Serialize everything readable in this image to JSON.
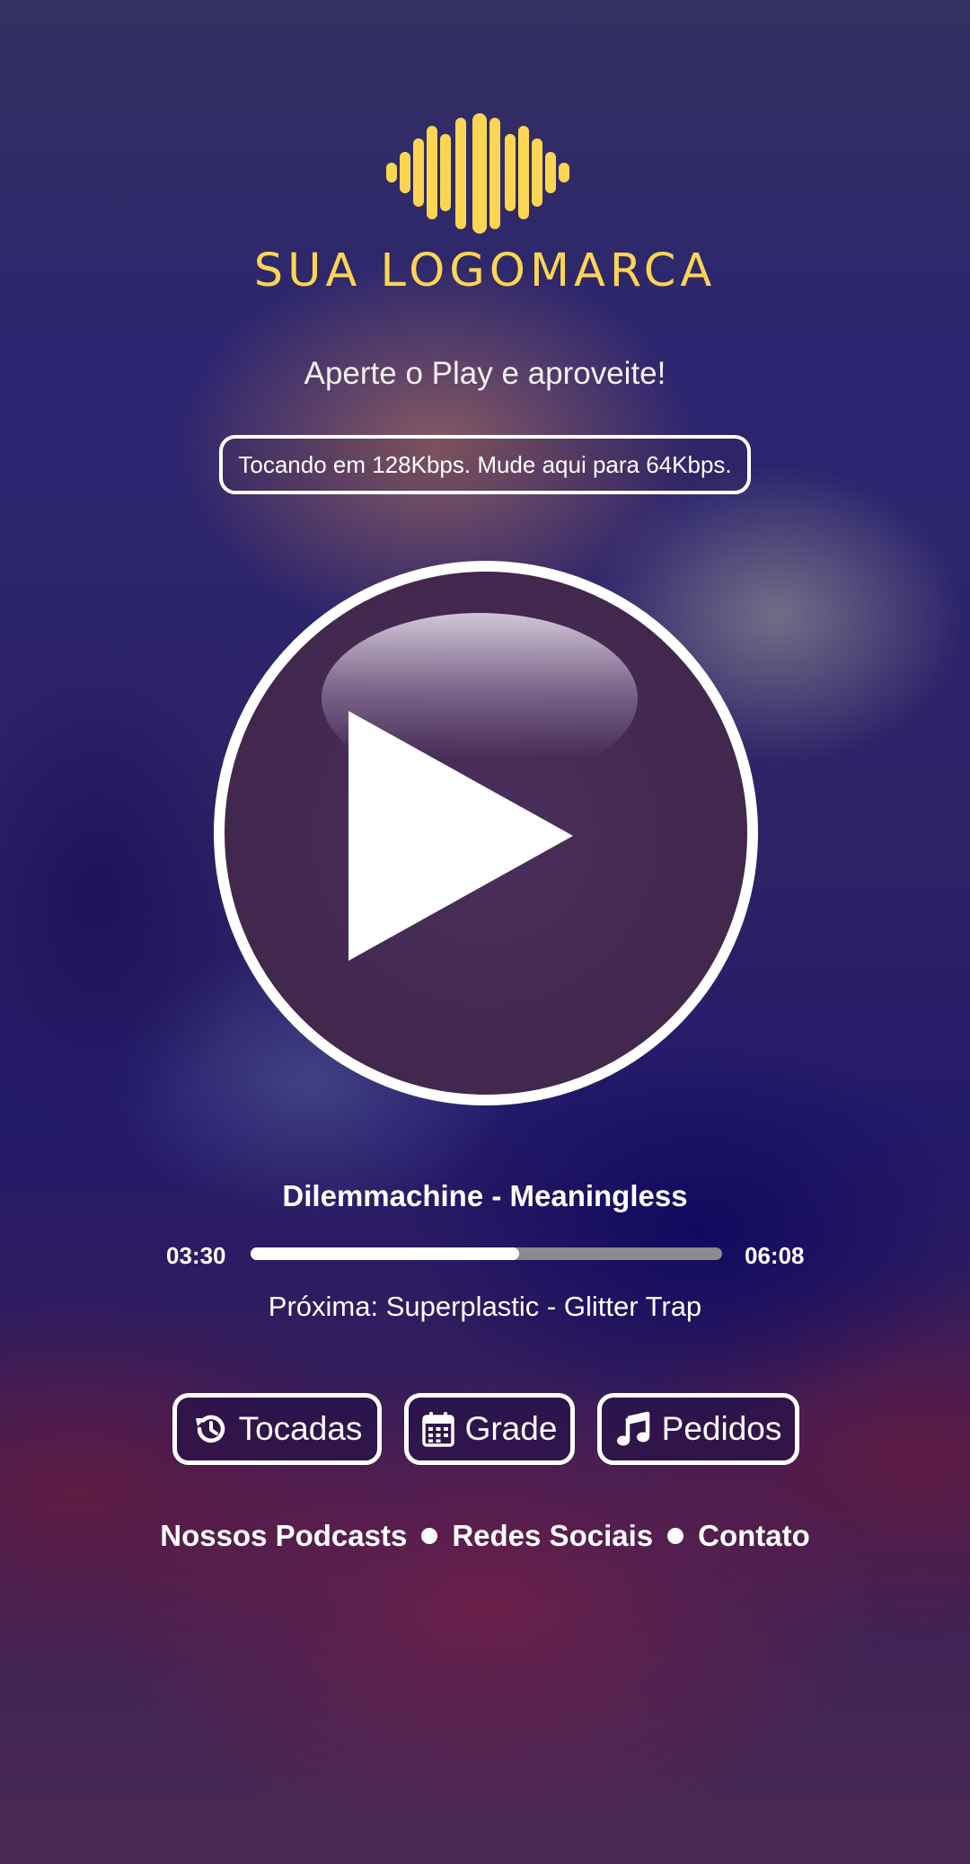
{
  "brand": {
    "logo_text": "SUA LOGOMARCA",
    "logo_color": "#fcd552",
    "logo_icon": "soundwave-icon"
  },
  "tagline": "Aperte o Play e aproveite!",
  "quality_toggle": {
    "label": "Tocando em 128Kbps. Mude aqui para 64Kbps."
  },
  "player": {
    "play_icon": "play-icon",
    "now_playing": "Dilemmachine - Meaningless",
    "elapsed": "03:30",
    "duration": "06:08",
    "progress_fraction": 0.57,
    "next_track": "Próxima: Superplastic - Glitter Trap"
  },
  "actions": [
    {
      "label": "Tocadas",
      "icon": "history-icon"
    },
    {
      "label": "Grade",
      "icon": "calendar-icon"
    },
    {
      "label": "Pedidos",
      "icon": "music-note-icon"
    }
  ],
  "footer": {
    "links": [
      "Nossos Podcasts",
      "Redes Sociais",
      "Contato"
    ]
  },
  "colors": {
    "accent": "#fcd552",
    "text": "#ffffff",
    "progress_track": "#8a8a8f"
  }
}
